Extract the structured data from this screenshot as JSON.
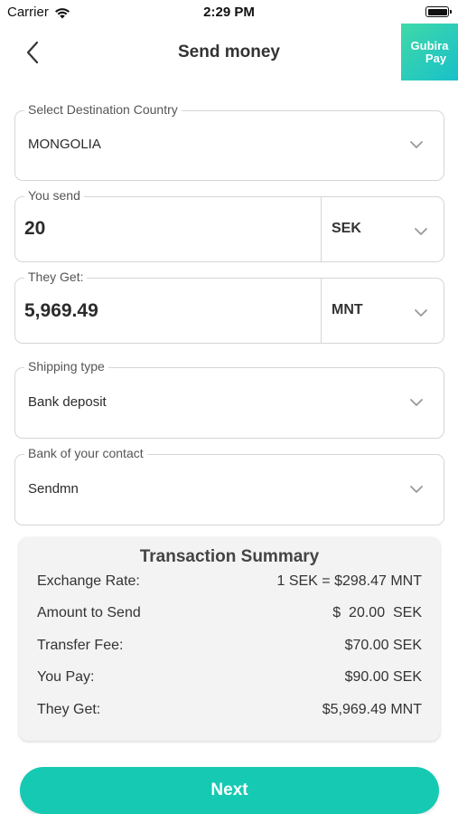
{
  "status_bar": {
    "carrier": "Carrier",
    "time": "2:29 PM"
  },
  "header": {
    "title": "Send money",
    "logo_line1": "Gubira",
    "logo_line2": "Pay"
  },
  "form": {
    "destination": {
      "label": "Select Destination Country",
      "value": "MONGOLIA"
    },
    "you_send": {
      "label": "You send",
      "value": "20",
      "currency": "SEK"
    },
    "they_get": {
      "label": "They Get:",
      "value": "5,969.49",
      "currency": "MNT"
    },
    "shipping_type": {
      "label": "Shipping type",
      "value": "Bank deposit"
    },
    "bank": {
      "label": "Bank of your contact",
      "value": "Sendmn"
    }
  },
  "summary": {
    "title": "Transaction Summary",
    "rows": [
      {
        "label": "Exchange Rate:",
        "value": "1 SEK = $298.47 MNT"
      },
      {
        "label": "Amount to Send",
        "value": "$  20.00  SEK"
      },
      {
        "label": "Transfer Fee:",
        "value": "$70.00 SEK"
      },
      {
        "label": "You Pay:",
        "value": "$90.00 SEK"
      },
      {
        "label": "They Get:",
        "value": "$5,969.49 MNT"
      }
    ]
  },
  "next_label": "Next",
  "colors": {
    "accent": "#16c9b2",
    "logo_start": "#3fd9a8",
    "logo_end": "#19c0c9"
  },
  "icons": {
    "back": "chevron-left-icon",
    "dropdown": "chevron-down-icon",
    "wifi": "wifi-icon",
    "battery": "battery-icon"
  }
}
